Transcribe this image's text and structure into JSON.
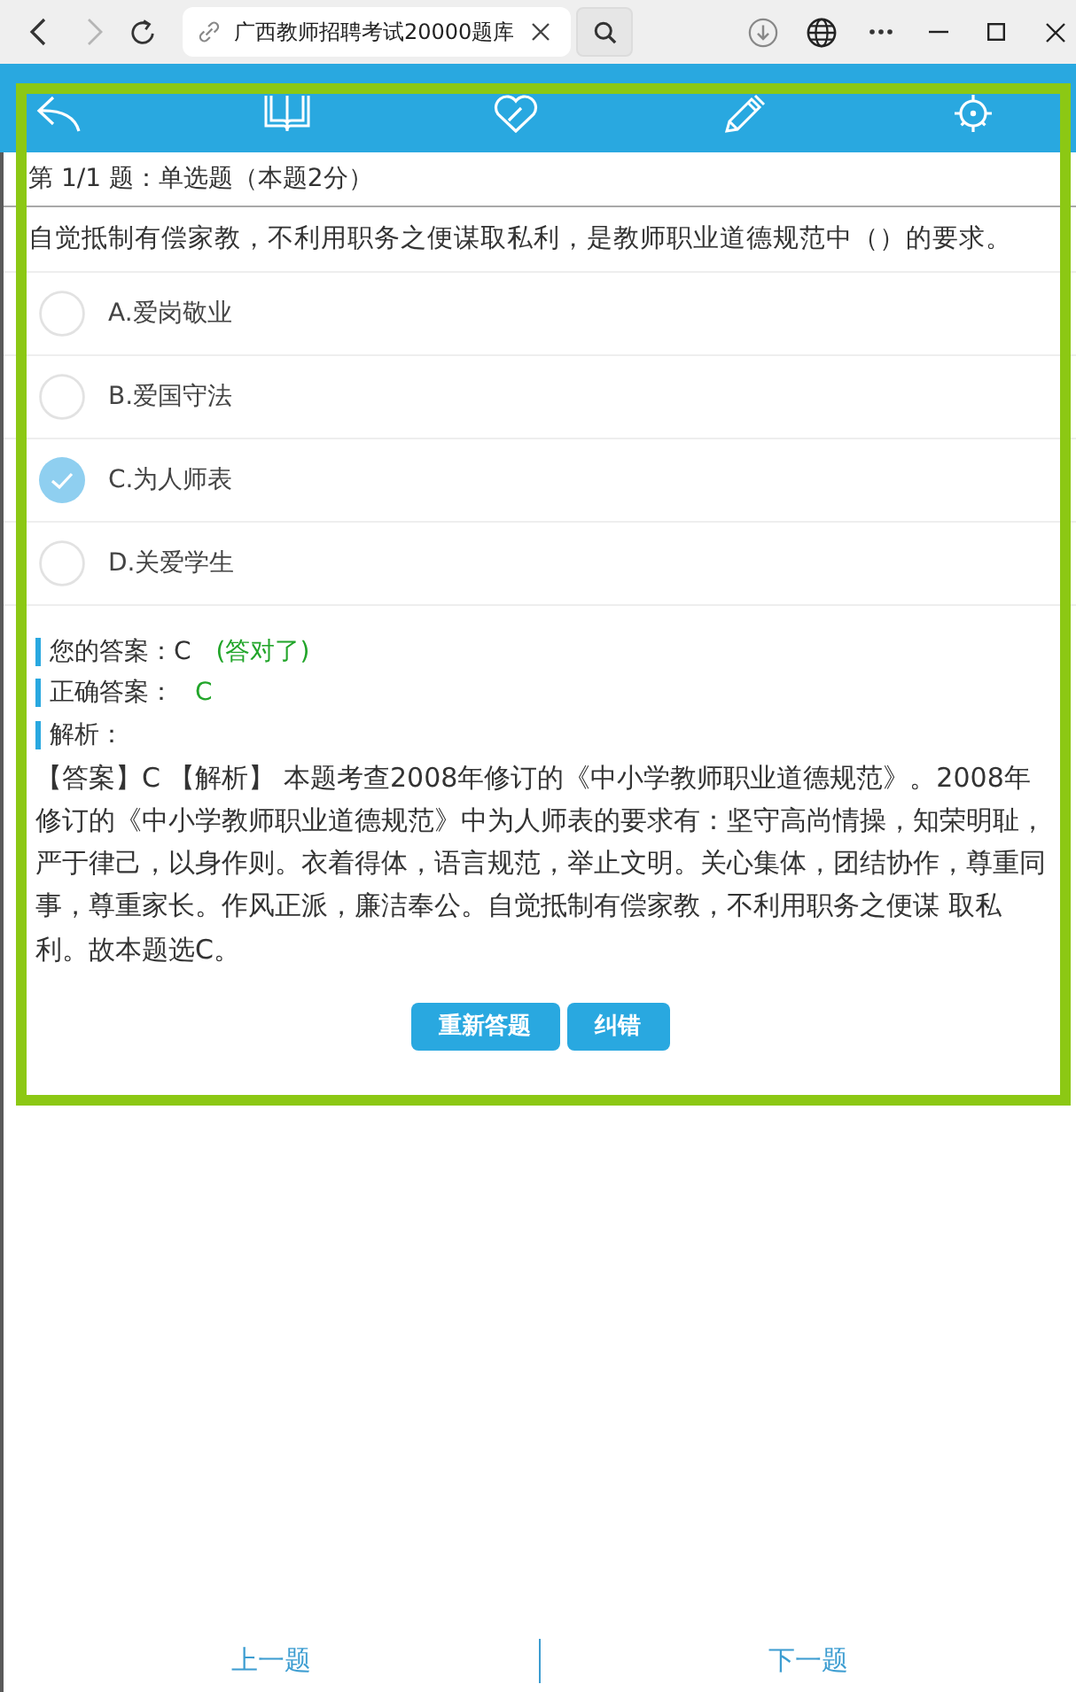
{
  "browser": {
    "tab_title": "广西教师招聘考试20000题库",
    "forward_disabled": true
  },
  "question": {
    "header": "第 1/1 题：单选题（本题2分）",
    "text": "自觉抵制有偿家教，不利用职务之便谋取私利，是教师职业道德规范中（）的要求。",
    "options": [
      {
        "label": "A.爱岗敬业",
        "selected": false
      },
      {
        "label": "B.爱国守法",
        "selected": false
      },
      {
        "label": "C.为人师表",
        "selected": true
      },
      {
        "label": "D.关爱学生",
        "selected": false
      }
    ]
  },
  "result": {
    "your_answer_label": "您的答案：",
    "your_answer": "C",
    "verdict": "(答对了)",
    "correct_answer_label": "正确答案：",
    "correct_answer": "C",
    "analysis_label": "解析：",
    "analysis": "【答案】C 【解析】 本题考查2008年修订的《中小学教师职业道德规范》。2008年修订的《中小学教师职业道德规范》中为人师表的要求有：坚守高尚情操，知荣明耻，严于律己，以身作则。衣着得体，语言规范，举止文明。关心集体，团结协作，尊重同事，尊重家长。作风正派，廉洁奉公。自觉抵制有偿家教，不利用职务之便谋 取私利。故本题选C。"
  },
  "buttons": [
    "重新答题",
    "纠错"
  ],
  "navigation": {
    "previous": "上一题",
    "next": "下一题"
  }
}
